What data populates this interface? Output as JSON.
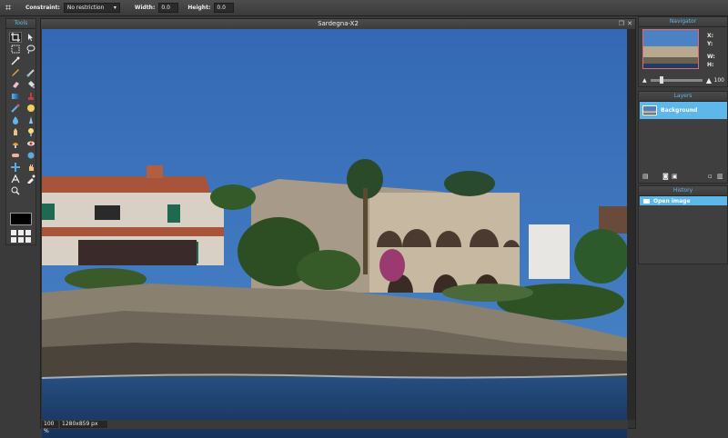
{
  "toolbar": {
    "constraint_label": "Constraint:",
    "constraint_value": "No restriction",
    "width_label": "Width:",
    "width_value": "0.0",
    "height_label": "Height:",
    "height_value": "0.0"
  },
  "tools": {
    "title": "Tools"
  },
  "document": {
    "title": "Sardegna-X2",
    "zoom": "100",
    "zoom_unit": "%",
    "dimensions": "1280x859 px"
  },
  "navigator": {
    "title": "Navigator",
    "x_label": "X:",
    "y_label": "Y:",
    "w_label": "W:",
    "h_label": "H:",
    "zoom_value": "100"
  },
  "layers": {
    "title": "Layers",
    "items": [
      {
        "name": "Background"
      }
    ]
  },
  "history": {
    "title": "History",
    "items": [
      {
        "label": "Open image"
      }
    ]
  },
  "colors": {
    "accent": "#5db7e8",
    "sky": "#3d79bf",
    "sea": "#1f3f6e"
  }
}
